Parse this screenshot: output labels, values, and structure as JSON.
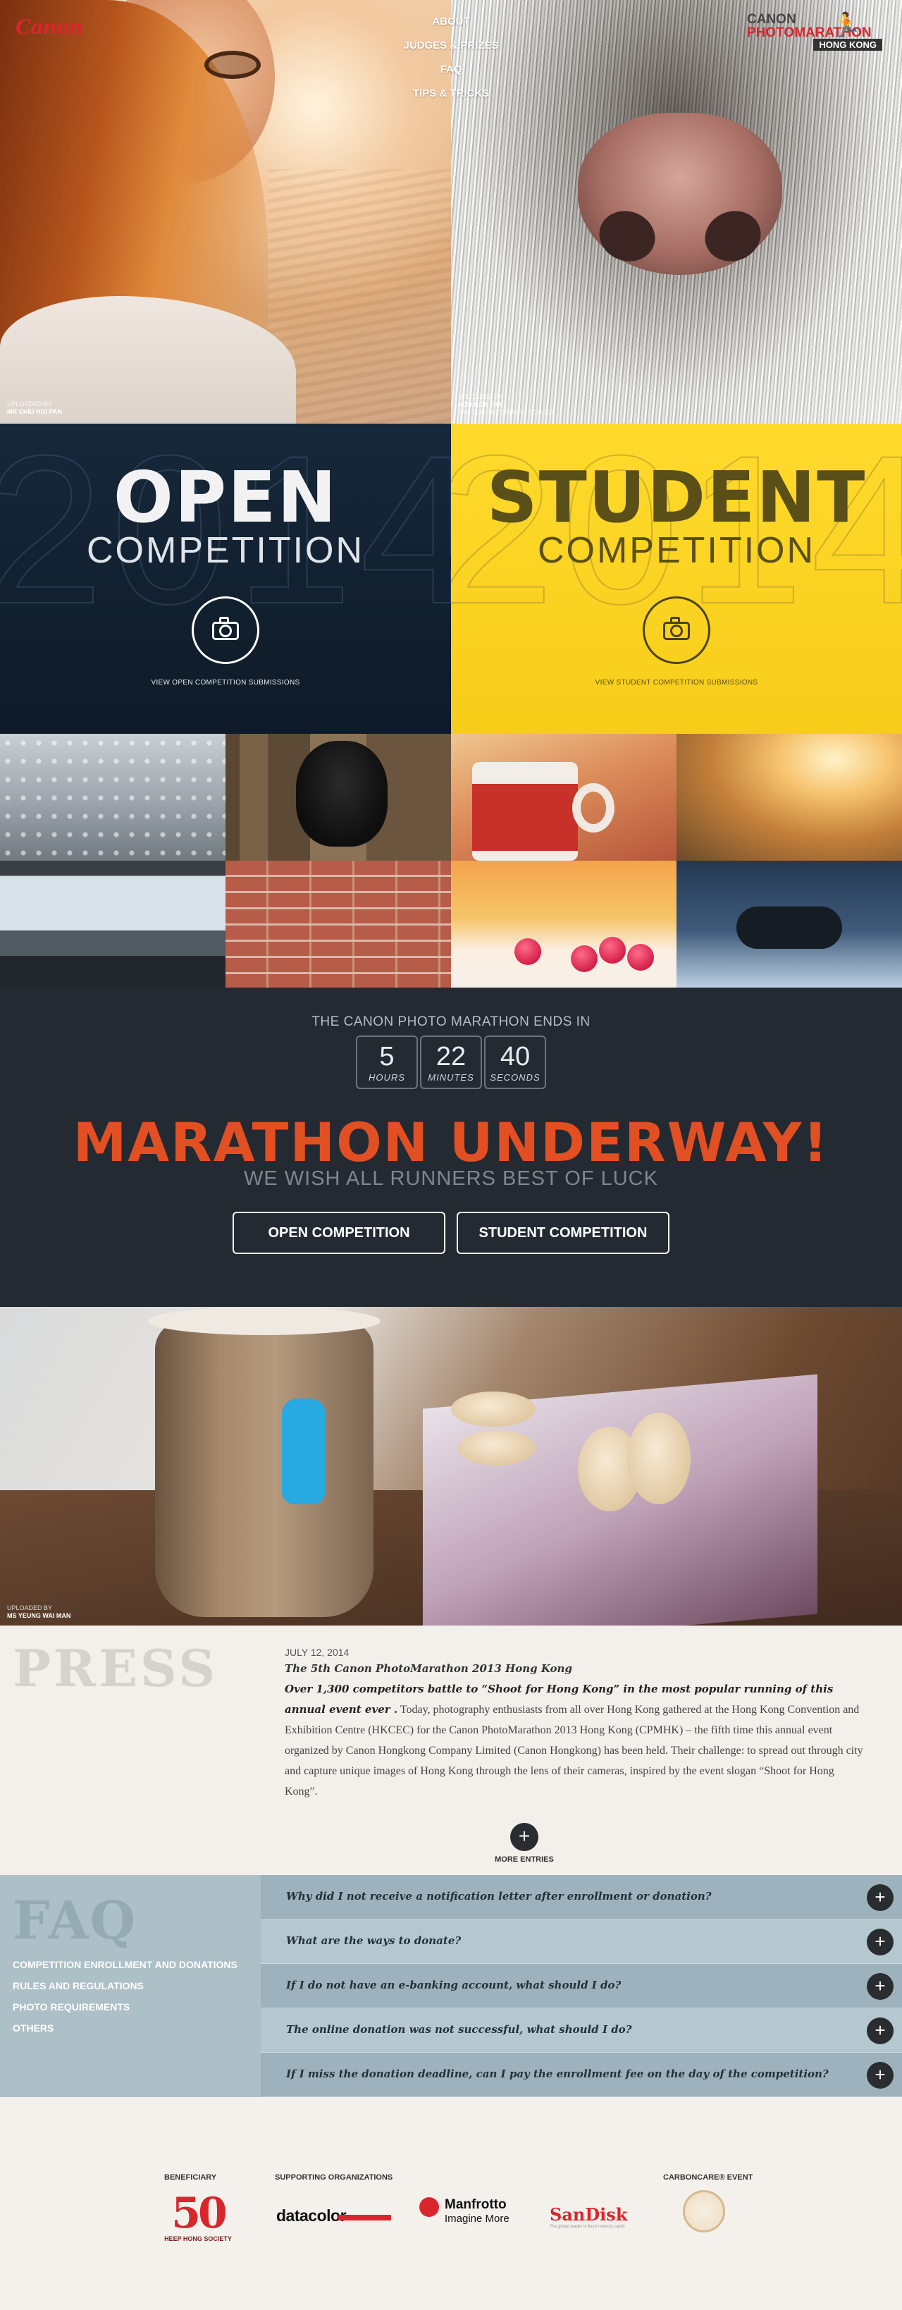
{
  "header": {
    "logo": "Canon",
    "nav": [
      "ABOUT",
      "JUDGES & PRIZES",
      "FAQ",
      "TIPS & TRICKS"
    ],
    "event_logo": {
      "line1": "CANON",
      "line2": "PHOTOMARATHON",
      "line3": "HONG KONG"
    }
  },
  "hero": {
    "left_credit": {
      "label": "UPLOADED BY",
      "name": "MR CHIU HOI PAN"
    },
    "right_credit": {
      "label": "UPLOADED BY",
      "name": "NGO KOK FAN",
      "school": "TAK SUN SECONDARY SCHOOL"
    }
  },
  "competitions": {
    "year": "2014",
    "open": {
      "title": "OPEN",
      "subtitle": "COMPETITION",
      "link": "VIEW OPEN COMPETITION SUBMISSIONS"
    },
    "student": {
      "title": "STUDENT",
      "subtitle": "COMPETITION",
      "link": "VIEW STUDENT COMPETITION SUBMISSIONS"
    }
  },
  "countdown": {
    "title": "THE CANON PHOTO MARATHON ENDS IN",
    "units": [
      {
        "value": "5",
        "label": "HOURS"
      },
      {
        "value": "22",
        "label": "MINUTES"
      },
      {
        "value": "40",
        "label": "SECONDS"
      }
    ],
    "headline": "MARATHON UNDERWAY!",
    "subline": "WE WISH ALL RUNNERS BEST OF LUCK",
    "buttons": {
      "open": "OPEN COMPETITION",
      "student": "STUDENT COMPETITION"
    }
  },
  "featured": {
    "credit": {
      "label": "UPLOADED BY",
      "name": "MS YEUNG WAI MAN"
    }
  },
  "press": {
    "title": "PRESS",
    "date": "JULY 12, 2014",
    "headline": "The 5th Canon PhotoMarathon 2013 Hong Kong",
    "lead": "Over 1,300 competitors battle to “Shoot for Hong Kong” in the most popular running of this annual event ever .",
    "body": " Today, photography enthusiasts from all over Hong Kong gathered at the Hong Kong Convention and Exhibition Centre (HKCEC) for the Canon PhotoMarathon 2013 Hong Kong (CPMHK) – the fifth time this annual event organized by Canon Hongkong Company Limited (Canon Hongkong) has been held. Their challenge: to spread out through city and capture unique images of Hong Kong through the lens of their cameras, inspired by the event slogan “Shoot for Hong Kong”.",
    "more": "MORE ENTRIES"
  },
  "faq": {
    "title": "FAQ",
    "categories": [
      "COMPETITION ENROLLMENT AND DONATIONS",
      "RULES AND REGULATIONS",
      "PHOTO REQUIREMENTS",
      "OTHERS"
    ],
    "questions": [
      "Why did I not receive a notification letter after enrollment or donation?",
      "What are the ways to donate?",
      "If I do not have an e-banking account, what should I do?",
      "The online donation was not successful, what should I do?",
      "If I miss the donation deadline, can I pay the enrollment fee on the day of the competition?"
    ]
  },
  "sponsors": {
    "labels": {
      "beneficiary": "BENEFICIARY",
      "supporting": "SUPPORTING ORGANIZATIONS",
      "carbon": "CARBONCARE® EVENT"
    },
    "heep": {
      "fifty": "50",
      "name": "HEEP HONG SOCIETY"
    },
    "datacolor": "datacolor",
    "manfrotto": {
      "name": "Manfrotto",
      "tag": "Imagine More"
    },
    "sandisk": {
      "name": "SanDisk",
      "tag": "The global leader in flash memory cards"
    }
  },
  "colors": {
    "accent": "#e24f23",
    "canon_red": "#d9262c",
    "open_bg": "#16283a",
    "student_bg": "#ffda2c",
    "dark_bg": "#232a32",
    "faq_bg": "#adbfc7"
  }
}
